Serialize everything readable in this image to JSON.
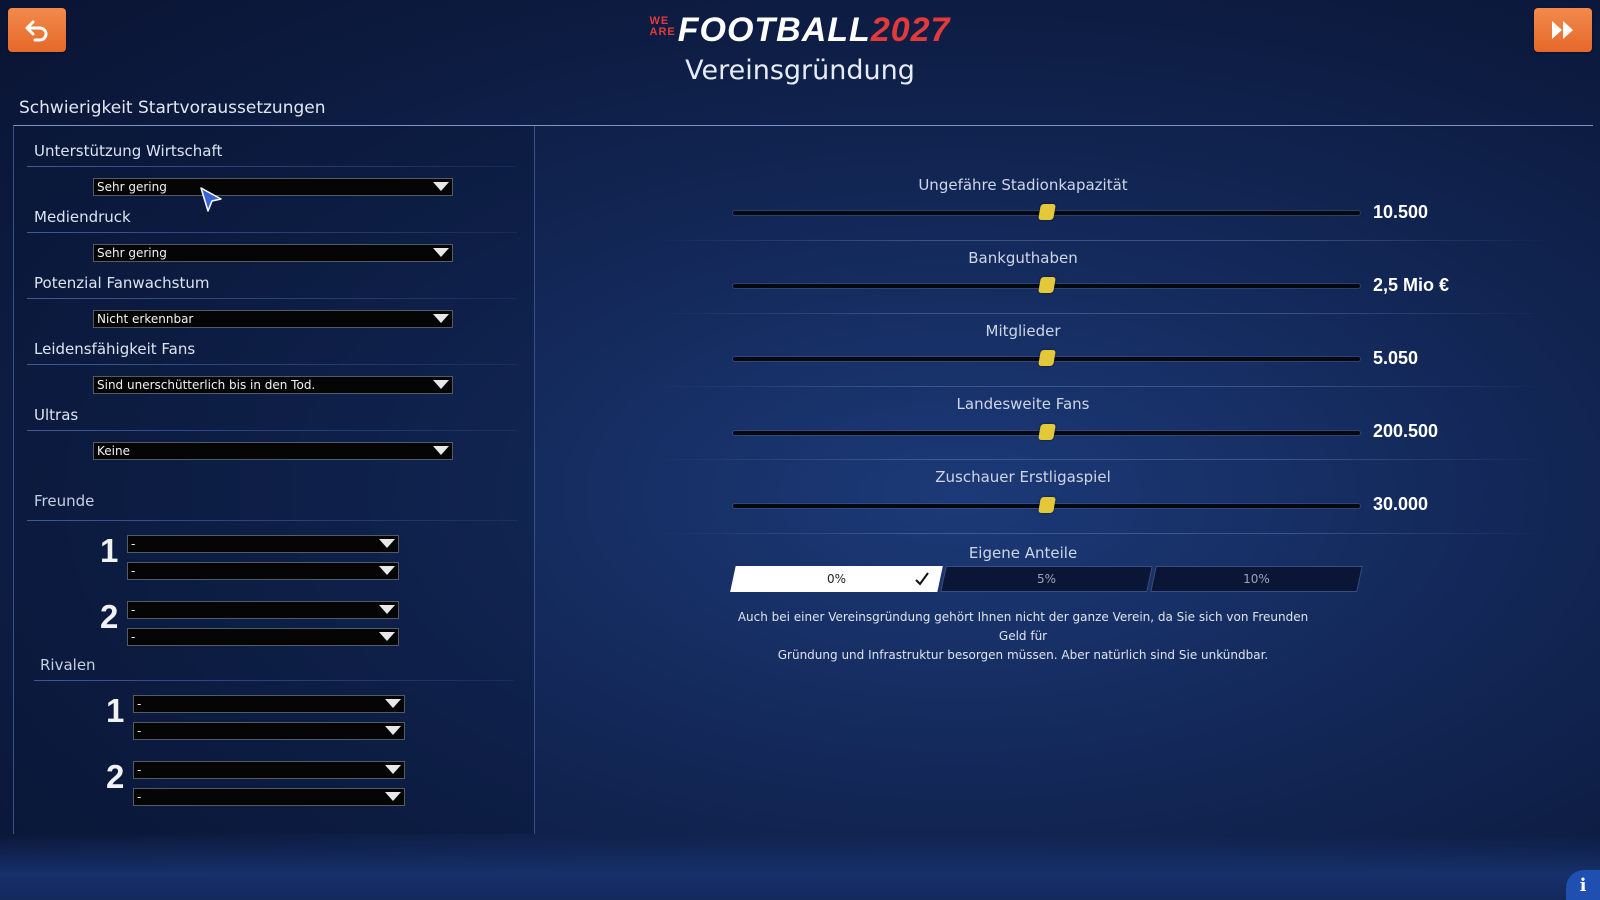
{
  "header": {
    "logo_we": "WE",
    "logo_are": "ARE",
    "logo_main": "FOOTBALL",
    "logo_year": "2027",
    "title": "Vereinsgründung",
    "back_icon": "back-arrow-icon",
    "next_icon": "fast-forward-icon"
  },
  "section_title": "Schwierigkeit Startvoraussetzungen",
  "settings": [
    {
      "label": "Unterstützung Wirtschaft",
      "value": "Sehr gering"
    },
    {
      "label": "Mediendruck",
      "value": "Sehr gering"
    },
    {
      "label": "Potenzial Fanwachstum",
      "value": "Nicht erkennbar"
    },
    {
      "label": "Leidensfähigkeit Fans",
      "value": "Sind unerschütterlich bis in den Tod."
    },
    {
      "label": "Ultras",
      "value": "Keine"
    }
  ],
  "friends": {
    "label": "Freunde",
    "groups": [
      {
        "num": "1",
        "values": [
          "-",
          "-"
        ]
      },
      {
        "num": "2",
        "values": [
          "-",
          "-"
        ]
      }
    ]
  },
  "rivals": {
    "label": "Rivalen",
    "groups": [
      {
        "num": "1",
        "values": [
          "-",
          "-"
        ]
      },
      {
        "num": "2",
        "values": [
          "-",
          "-"
        ]
      }
    ]
  },
  "sliders": [
    {
      "label": "Ungefähre Stadionkapazität",
      "value": "10.500",
      "position": 0.5
    },
    {
      "label": "Bankguthaben",
      "value": "2,5 Mio €",
      "position": 0.5
    },
    {
      "label": "Mitglieder",
      "value": "5.050",
      "position": 0.5
    },
    {
      "label": "Landesweite Fans",
      "value": "200.500",
      "position": 0.5
    },
    {
      "label": "Zuschauer Erstligaspiel",
      "value": "30.000",
      "position": 0.5
    }
  ],
  "shares": {
    "label": "Eigene Anteile",
    "options": [
      "0%",
      "5%",
      "10%"
    ],
    "selected": "0%",
    "note_line1": "Auch bei einer Vereinsgründung gehört Ihnen nicht der ganze Verein, da Sie sich von Freunden Geld für",
    "note_line2": "Gründung und Infrastruktur besorgen müssen. Aber natürlich sind Sie unkündbar."
  },
  "info_button": "i",
  "colors": {
    "accent_orange": "#e5682a",
    "logo_red": "#e23a3a",
    "slider_handle": "#e3c83a",
    "background": "#142a5c"
  }
}
